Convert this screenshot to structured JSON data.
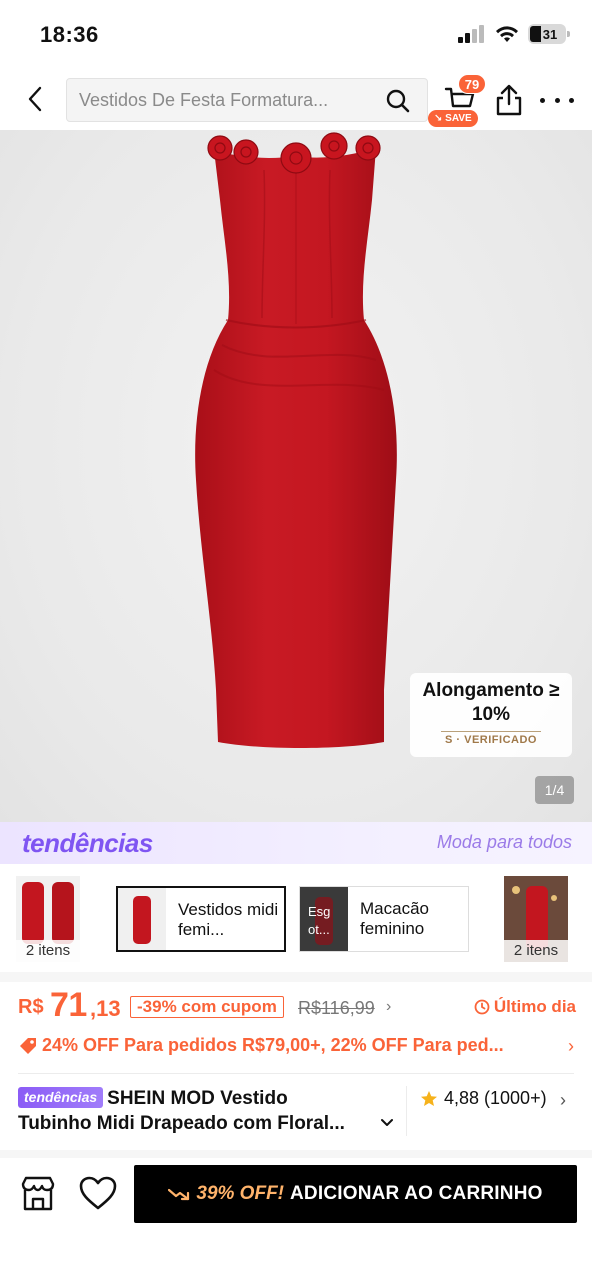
{
  "status_bar": {
    "time": "18:36",
    "battery": "31"
  },
  "header": {
    "search_placeholder": "Vestidos De Festa Formatura...",
    "cart_count": "79",
    "save_label": "SAVE"
  },
  "product_image": {
    "stretch_title": "Alongamento ≥ 10%",
    "stretch_verified": "S · VERIFICADO",
    "counter": "1/4",
    "dress_color": "#c0161f"
  },
  "trends": {
    "logo": "tendências",
    "slogan": "Moda para todos"
  },
  "categories": {
    "left_thumb_count": "2 itens",
    "chip1_label": "Vestidos midi femi...",
    "chip2_img_text": "Esg ot...",
    "chip2_label": "Macacão feminino",
    "right_thumb_count": "2 itens"
  },
  "price": {
    "currency": "R$",
    "main": "71",
    "cents": ",13",
    "discount": "-39% com cupom",
    "old_price": "R$116,99",
    "last_day": "Último dia"
  },
  "promo": {
    "text": "24% OFF Para pedidos R$79,00+,  22% OFF Para ped..."
  },
  "product": {
    "badge": "tendências",
    "title_line1": "SHEIN MOD Vestido",
    "title_line2": "Tubinho Midi Drapeado com Floral...",
    "rating": "4,88 (1000+)"
  },
  "bottom_bar": {
    "add_cart_off": "39% OFF!",
    "add_cart_label": "ADICIONAR AO CARRINHO"
  },
  "colors": {
    "accent": "#fa6338",
    "trend": "#7f55f2"
  }
}
